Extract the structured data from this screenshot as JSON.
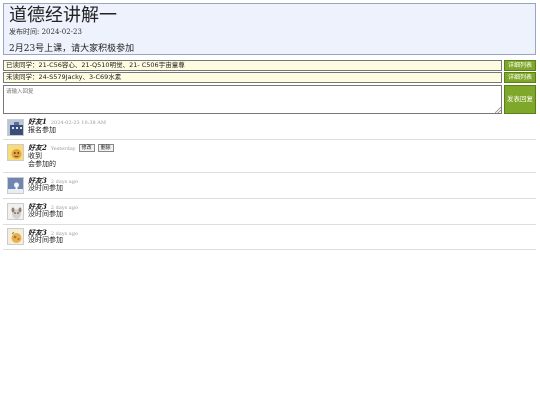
{
  "header": {
    "title": "道德经讲解一",
    "date_label": "发布时间:",
    "date_value": "2024-02-23",
    "notice": "2月23号上课，请大家积极参加"
  },
  "read_bar": {
    "label": "已读同学：",
    "names": "21-C56容心、21-Q510明觉、21- C506宇宙童尊",
    "button": "详细列表"
  },
  "unread_bar": {
    "label": "未读同学：",
    "names": "24-S579Jacky、3-C69水素",
    "button": "详细列表"
  },
  "reply": {
    "placeholder": "请输入回复",
    "post_button": "发表回复"
  },
  "comments": [
    {
      "name": "好友1",
      "time": "2024-02-23 10:38 AM",
      "lines": [
        "报名参加"
      ],
      "actions": [],
      "avatar": "building-avatar"
    },
    {
      "name": "好友2",
      "time": "Yesterday",
      "lines": [
        "收到",
        "会参加的"
      ],
      "actions": [
        "修改",
        "删除"
      ],
      "avatar": "cartoon-avatar"
    },
    {
      "name": "好友3",
      "time": "2 days ago",
      "lines": [
        "没时间参加"
      ],
      "actions": [],
      "avatar": "snow-avatar"
    },
    {
      "name": "好友3",
      "time": "2 days ago",
      "lines": [
        "没时间参加"
      ],
      "actions": [],
      "avatar": "puppy-avatar"
    },
    {
      "name": "好友3",
      "time": "2 days ago",
      "lines": [
        "没时间参加"
      ],
      "actions": [],
      "avatar": "food-avatar"
    }
  ],
  "colors": {
    "header_bg": "#eef2fc",
    "bar_bg": "#fdfbe0",
    "button_green": "#7fa82a"
  }
}
